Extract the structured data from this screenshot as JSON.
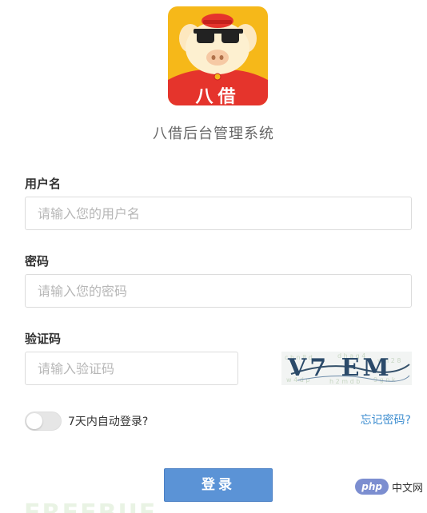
{
  "app": {
    "logo_text": "八借",
    "title": "八借后台管理系统"
  },
  "form": {
    "username": {
      "label": "用户名",
      "placeholder": "请输入您的用户名",
      "value": ""
    },
    "password": {
      "label": "密码",
      "placeholder": "请输入您的密码",
      "value": ""
    },
    "captcha": {
      "label": "验证码",
      "placeholder": "请输入验证码",
      "value": "",
      "image_text": "V7 EM"
    },
    "remember": {
      "label": "7天内自动登录?",
      "checked": false
    },
    "forgot_label": "忘记密码?",
    "submit_label": "登录"
  },
  "watermark": {
    "left_text": "FREEBUF",
    "badge": "php",
    "site": "中文网"
  },
  "colors": {
    "primary": "#5b93d6",
    "link": "#3e8ed0",
    "logo_bg": "#f6b819",
    "logo_red": "#e5342c"
  }
}
